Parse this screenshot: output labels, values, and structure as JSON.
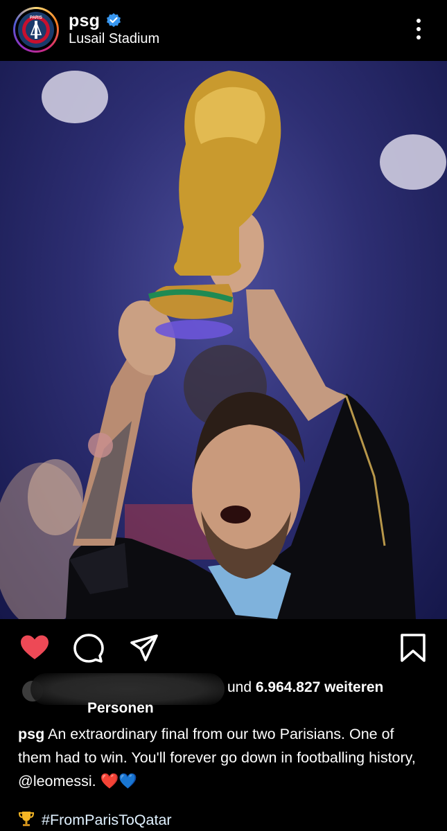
{
  "post": {
    "username": "psg",
    "location": "Lusail Stadium",
    "avatar_text": "PARIS"
  },
  "likes": {
    "prefix": "und",
    "count": "6.964.827",
    "suffix": "weiteren",
    "line2": "Personen"
  },
  "caption": {
    "username": "psg",
    "text": "An extraordinary final from our two Parisians. One of them had to win. You'll forever go down in footballing history, @leomessi. ❤️💙",
    "hashtag": "#FromParisToQatar"
  },
  "colors": {
    "like_red": "#ed4956",
    "verified_blue": "#3897f0",
    "background": "#000000"
  },
  "icons": [
    "more-options-icon",
    "verified-icon",
    "heart-icon",
    "comment-icon",
    "share-icon",
    "bookmark-icon",
    "trophy-icon"
  ]
}
